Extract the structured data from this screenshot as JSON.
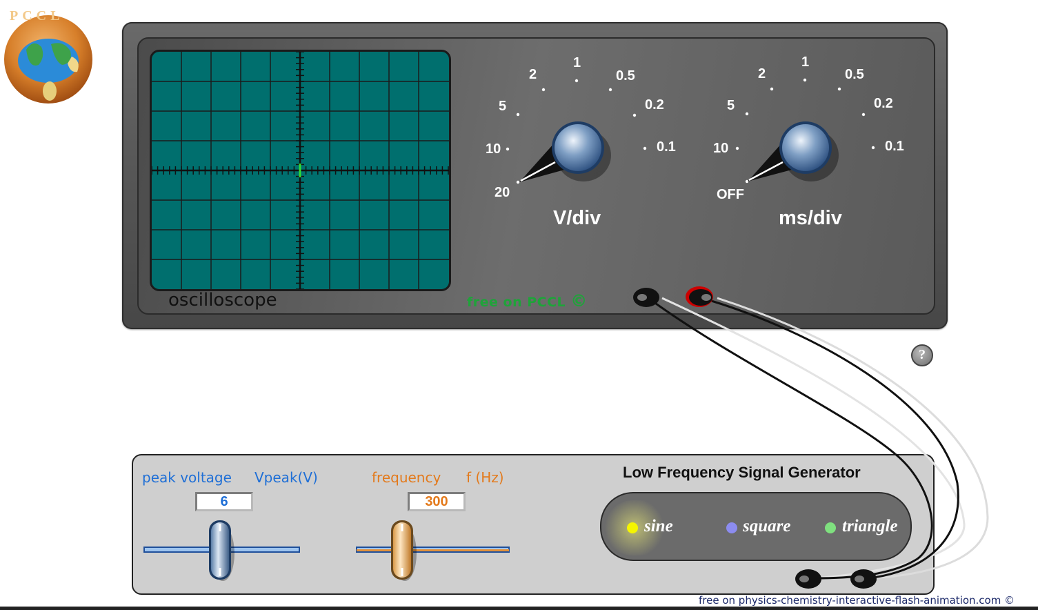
{
  "logo": {
    "letters": "PCCL",
    "name": "pccl-globe-logo"
  },
  "oscilloscope": {
    "label": "oscilloscope",
    "watermark": "free on PCCL",
    "copyright_symbol": "©",
    "volts_knob": {
      "title": "V/div",
      "scale": [
        "20",
        "10",
        "5",
        "2",
        "1",
        "0.5",
        "0.2",
        "0.1"
      ],
      "selected": "20"
    },
    "time_knob": {
      "title": "ms/div",
      "scale": [
        "OFF",
        "10",
        "5",
        "2",
        "1",
        "0.5",
        "0.2",
        "0.1"
      ],
      "selected": "OFF"
    },
    "screen": {
      "color": "#006f6e",
      "trace_color": "#33dd33"
    }
  },
  "help": {
    "label": "?"
  },
  "generator": {
    "title": "Low Frequency Signal Generator",
    "voltage": {
      "label": "peak voltage",
      "unit_label": "Vpeak(V)",
      "value": "6",
      "color": "#1f6fd6"
    },
    "frequency": {
      "label": "frequency",
      "unit_label": "f (Hz)",
      "value": "300",
      "color": "#e37a1c"
    },
    "waveforms": [
      {
        "label": "sine",
        "led_color": "#f5f500",
        "active": true
      },
      {
        "label": "square",
        "led_color": "#8c8cf0",
        "active": false
      },
      {
        "label": "triangle",
        "led_color": "#7fe07f",
        "active": false
      }
    ]
  },
  "footer": {
    "text": "free on physics-chemistry-interactive-flash-animation.com ©"
  }
}
